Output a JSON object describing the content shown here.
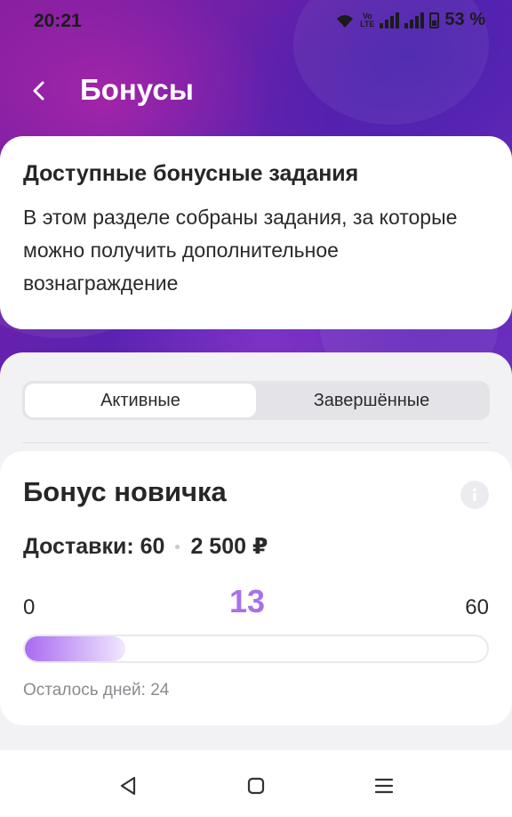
{
  "status_bar": {
    "time": "20:21",
    "battery_percent": "53 %",
    "volte_top": "Vo",
    "volte_bottom": "LTE"
  },
  "header": {
    "title": "Бонусы",
    "back_icon": "chevron-left-icon"
  },
  "info_card": {
    "title": "Доступные бонусные задания",
    "description": "В этом разделе собраны задания, за которые можно получить дополнительное вознаграждение"
  },
  "tabs": [
    {
      "label": "Активные",
      "active": true
    },
    {
      "label": "Завершённые",
      "active": false
    }
  ],
  "bonus": {
    "title": "Бонус новичка",
    "info_icon": "info-icon",
    "deliveries_label": "Доставки: 60",
    "reward": "2 500 ₽",
    "range_min": "0",
    "range_max": "60",
    "current": "13",
    "progress_fraction": 0.2167,
    "days_left": "Осталось дней: 24"
  },
  "colors": {
    "accent": "#a772e8",
    "hero_purple": "#6b2fc0"
  },
  "nav_bar": {
    "icons": [
      "back-triangle-icon",
      "home-square-icon",
      "menu-lines-icon"
    ]
  }
}
